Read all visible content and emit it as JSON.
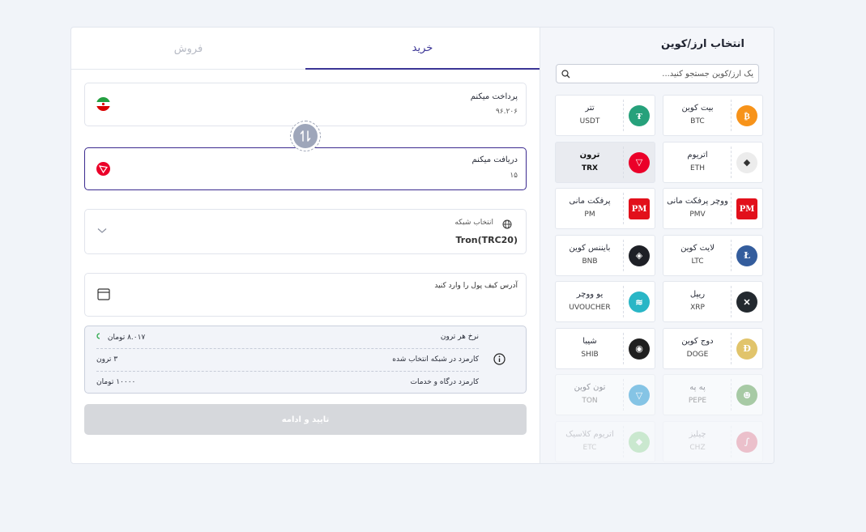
{
  "tabs": {
    "buy": "خرید",
    "sell": "فروش"
  },
  "pay": {
    "label": "پرداخت میکنم",
    "value": "۹۶.۲۰۶"
  },
  "receive": {
    "label": "دریافت میکنم",
    "value": "۱۵"
  },
  "network": {
    "label": "انتخاب شبکه",
    "value": "Tron(TRC20)"
  },
  "wallet": {
    "placeholder": "آدرس کیف پول را وارد کنید"
  },
  "info": {
    "rate_label": "نرخ هر ترون",
    "rate_value": "۸.۰۱۷ تومان",
    "network_fee_label": "کارمزد در شبکه انتخاب شده",
    "network_fee_value": "۳ ترون",
    "gateway_fee_label": "کارمزد درگاه و خدمات",
    "gateway_fee_value": "۱۰۰۰۰  تومان"
  },
  "submit_label": "تایید و ادامه",
  "coin_panel": {
    "title": "انتخاب ارز/کوین",
    "search_placeholder": "یک ارز/کوین جستجو کنید...",
    "coins": [
      {
        "name": "بیت کوین",
        "symbol": "BTC",
        "color": "#f7931a",
        "icon": "bitcoin-icon"
      },
      {
        "name": "تتر",
        "symbol": "USDT",
        "color": "#26a17b",
        "icon": "tether-icon"
      },
      {
        "name": "اتریوم",
        "symbol": "ETH",
        "color": "#ececec",
        "icon": "ethereum-icon"
      },
      {
        "name": "ترون",
        "symbol": "TRX",
        "color": "#eb0029",
        "icon": "tron-icon"
      },
      {
        "name": "ووچر پرفکت مانی",
        "symbol": "PMV",
        "color": "#e2101b",
        "icon": "perfectmoney-icon"
      },
      {
        "name": "پرفکت مانی",
        "symbol": "PM",
        "color": "#e2101b",
        "icon": "perfectmoney-icon"
      },
      {
        "name": "لایت کوین",
        "symbol": "LTC",
        "color": "#345d9d",
        "icon": "litecoin-icon"
      },
      {
        "name": "بایننس کوین",
        "symbol": "BNB",
        "color": "#1e2026",
        "icon": "bnb-icon"
      },
      {
        "name": "ریپل",
        "symbol": "XRP",
        "color": "#23292f",
        "icon": "ripple-icon"
      },
      {
        "name": "یو ووچر",
        "symbol": "UVOUCHER",
        "color": "#29b6c6",
        "icon": "uvoucher-icon"
      },
      {
        "name": "دوج کوین",
        "symbol": "DOGE",
        "color": "#e1c46b",
        "icon": "dogecoin-icon"
      },
      {
        "name": "شیبا",
        "symbol": "SHIB",
        "color": "#1f1f1f",
        "icon": "shiba-icon"
      },
      {
        "name": "په په",
        "symbol": "PEPE",
        "color": "#4c9540",
        "icon": "pepe-icon"
      },
      {
        "name": "تون کوین",
        "symbol": "TON",
        "color": "#0088cc",
        "icon": "toncoin-icon"
      },
      {
        "name": "چیلیز",
        "symbol": "CHZ",
        "color": "#cd0124",
        "icon": "chiliz-icon"
      },
      {
        "name": "اتریوم کلاسیک",
        "symbol": "ETC",
        "color": "#3ab83a",
        "icon": "ethereum-classic-icon"
      }
    ]
  }
}
